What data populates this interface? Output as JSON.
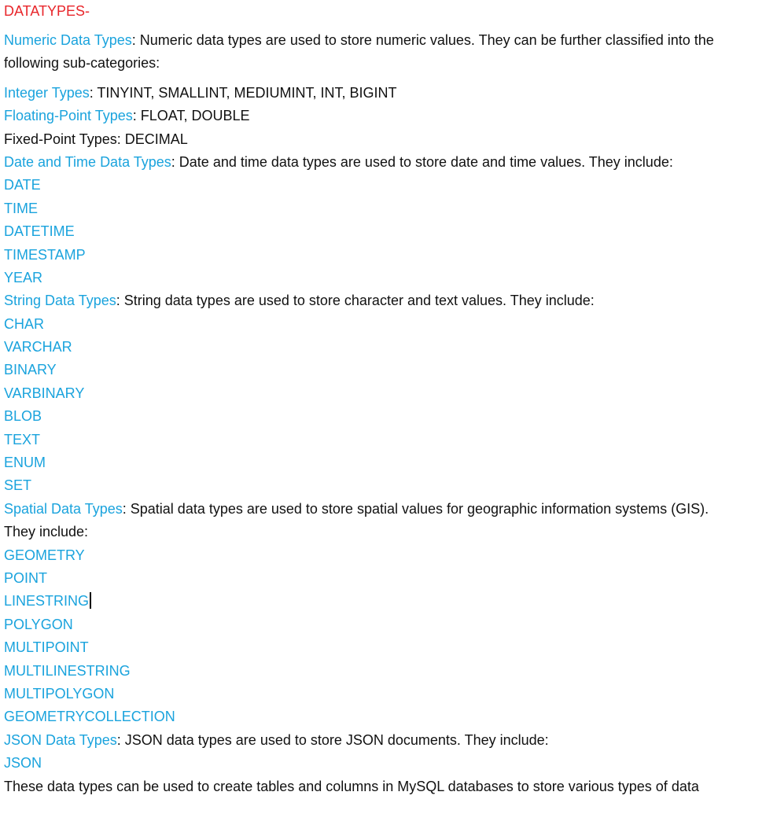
{
  "title": "DATATYPES-",
  "numeric": {
    "heading": "Numeric Data Types",
    "text": ": Numeric data types are used to store numeric values. They can be further classified into the",
    "text2": "following sub-categories:"
  },
  "integer": {
    "heading": "Integer Types",
    "text": ": TINYINT, SMALLINT, MEDIUMINT, INT, BIGINT"
  },
  "floating": {
    "heading": "Floating-Point Types",
    "text": ": FLOAT, DOUBLE"
  },
  "fixed": {
    "text": "Fixed-Point Types: DECIMAL"
  },
  "datetime": {
    "heading": "Date and Time Data Types",
    "text": ": Date and time data types are used to store date and time values. They include:",
    "items": [
      "DATE",
      "TIME",
      "DATETIME",
      "TIMESTAMP",
      "YEAR"
    ]
  },
  "string": {
    "heading": "String Data Types",
    "text": ": String data types are used to store character and text values. They include:",
    "items": [
      "CHAR",
      "VARCHAR",
      "BINARY",
      "VARBINARY",
      "BLOB",
      "TEXT",
      "ENUM",
      "SET"
    ]
  },
  "spatial": {
    "heading": "Spatial Data Types",
    "text": ": Spatial data types are used to store spatial values for geographic information systems (GIS).",
    "text2": "They include:",
    "items": [
      "GEOMETRY",
      "POINT",
      "LINESTRING",
      "POLYGON",
      "MULTIPOINT",
      "MULTILINESTRING",
      "MULTIPOLYGON",
      "GEOMETRYCOLLECTION"
    ]
  },
  "json": {
    "heading": "JSON Data Types",
    "text": ": JSON data types are used to store JSON documents. They include:",
    "items": [
      "JSON"
    ]
  },
  "closing": {
    "text": "These data types can be used to create tables and columns in MySQL databases to store various types of data"
  }
}
